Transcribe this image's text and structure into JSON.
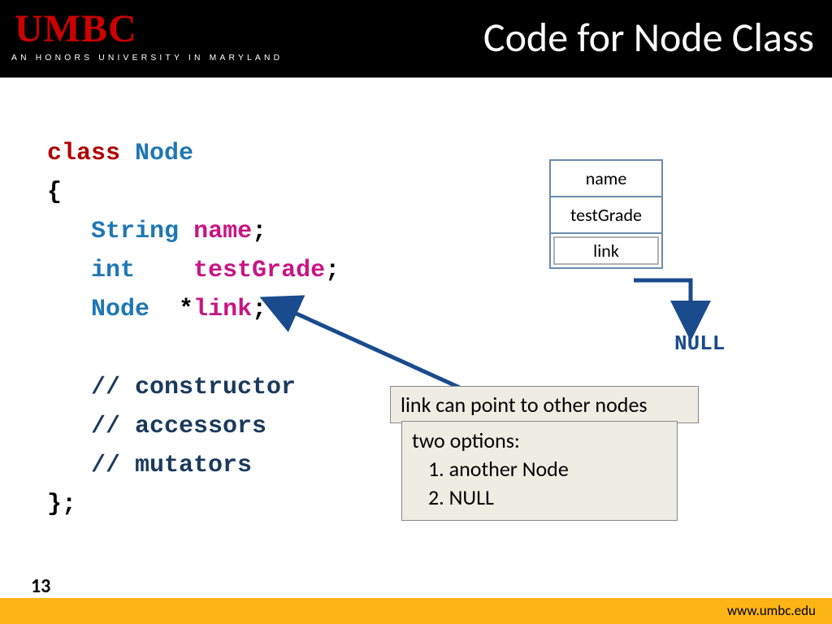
{
  "header": {
    "logo_text": "UMBC",
    "logo_color": "#CC0000",
    "tagline": "AN HONORS UNIVERSITY IN MARYLAND",
    "title": "Code for Node Class"
  },
  "code": {
    "kw_class": "class",
    "type_node": "Node",
    "lbrace": "{",
    "type_string": "String",
    "field_name": "name",
    "semi": ";",
    "type_int": "int",
    "field_testGrade": "testGrade",
    "type_node2": "Node",
    "star": "*",
    "field_link": "link",
    "comment_ctor": "// constructor",
    "comment_acc": "// accessors",
    "comment_mut": "// mutators",
    "rbrace": "};"
  },
  "diagram": {
    "cells": [
      "name",
      "testGrade",
      "link"
    ],
    "null_label": "NULL"
  },
  "callouts": {
    "link_explain": "link can point to other nodes",
    "options_title": "two options:",
    "option1": "1.   another Node",
    "option2": "2.   NULL"
  },
  "footer": {
    "slide_number": "13",
    "url": "www.umbc.edu",
    "bar_color": "#FDB515"
  }
}
